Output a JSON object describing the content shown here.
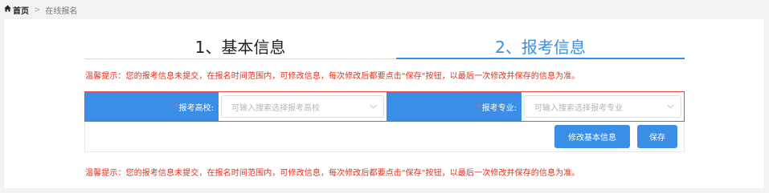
{
  "breadcrumb": {
    "home_label": "首页",
    "separator": ">",
    "current": "在线报名"
  },
  "steps": [
    {
      "label": "1、基本信息",
      "active": false
    },
    {
      "label": "2、报考信息",
      "active": true
    }
  ],
  "tips": {
    "top": "温馨提示：您的报考信息未提交，在报名时间范围内，可修改信息，每次修改后都要点击\"保存\"按钮，以最后一次修改并保存的信息为准。",
    "bottom": "温馨提示：您的报考信息未提交，在报名时间范围内，可修改信息，每次修改后都要点击\"保存\"按钮，以最后一次修改并保存的信息为准。"
  },
  "form": {
    "school": {
      "required_mark": "*",
      "label": "报考高校:",
      "placeholder": "可输入搜索选择报考高校"
    },
    "major": {
      "required_mark": "*",
      "label": "报考专业:",
      "placeholder": "可输入搜索选择报考专业"
    }
  },
  "buttons": {
    "edit_basic": "修改基本信息",
    "save": "保存"
  },
  "colors": {
    "accent": "#3a8ee6",
    "warning": "#e0301e",
    "error_border": "#f04848"
  }
}
